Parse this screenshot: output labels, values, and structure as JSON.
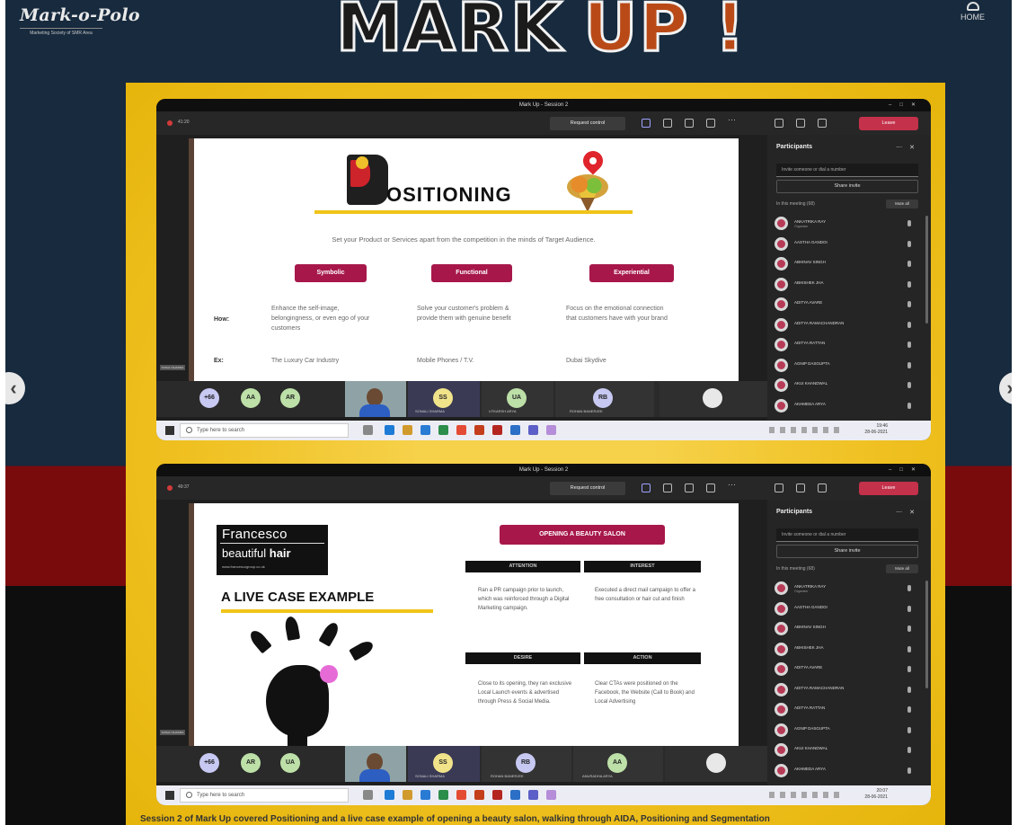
{
  "page": {
    "brand_name": "Mark-o-Polo",
    "brand_tagline": "Marketing Society of SMR Area",
    "headline_word1": "MARK",
    "headline_word2": "UP !",
    "corner_right_label": "HOME",
    "bottom_caption": "Session 2 of Mark Up covered Positioning and a live case example of opening a beauty salon, walking through AIDA, Positioning and Segmentation",
    "colors": {
      "navy": "#172a3e",
      "maroon": "#7a0b0d",
      "yellow": "#efc020",
      "slide_accent": "#a7174a",
      "leave_red": "#c4314b"
    },
    "icons": {
      "left_arrow": "chevron-left-icon",
      "right_arrow": "chevron-right-icon"
    }
  },
  "window1": {
    "title": "Mark Up - Session 2",
    "timer": "41:20",
    "request_control": "Request control",
    "leave": "Leave",
    "slide": {
      "title": "OSITIONING",
      "subtitle": "Set your Product or Services apart from the competition in the minds of Target Audience.",
      "categories": [
        "Symbolic",
        "Functional",
        "Experiential"
      ],
      "how_label": "How:",
      "how": [
        "Enhance the self-image, belongingness, or even ego of your customers",
        "Solve your customer's problem & provide them with genuine benefit",
        "Focus on the emotional connection that customers have with your brand"
      ],
      "ex_label": "Ex:",
      "examples": [
        "The Luxury Car Industry",
        "Mobile Phones / T.V.",
        "Dubai Skydive"
      ]
    },
    "strip": {
      "tiles": [
        {
          "initials": "+66",
          "label": ""
        },
        {
          "initials": "AA",
          "label": ""
        },
        {
          "initials": "AR",
          "label": ""
        },
        {
          "initials": "SS",
          "label": "SONALI SHARMA"
        },
        {
          "initials": "UA",
          "label": "UTKARSH ARYA"
        },
        {
          "initials": "RB",
          "label": "ROHAN BANERJEE"
        }
      ],
      "video_label": "SONALI SHARMA"
    },
    "taskbar": {
      "search_placeholder": "Type here to search",
      "time": "19:46",
      "date": "28-06-2021"
    }
  },
  "window2": {
    "title": "Mark Up - Session 2",
    "timer": "49:37",
    "request_control": "Request control",
    "leave": "Leave",
    "slide": {
      "logo_line1": "Francesco",
      "logo_line2a": "beautiful ",
      "logo_line2b": "hair",
      "logo_line3": "www.francescogroup.co.uk",
      "live_title": "A LIVE CASE EXAMPLE",
      "banner": "OPENING A BEAUTY SALON",
      "aida": [
        {
          "head": "ATTENTION",
          "text": "Ran a PR campaign prior to launch, which was reinforced through a Digital Marketing campaign."
        },
        {
          "head": "INTEREST",
          "text": "Executed a direct mail campaign to offer a free consultation or hair cut and finish"
        },
        {
          "head": "DESIRE",
          "text": "Close to its opening, they ran exclusive Local Launch events & advertised through Press & Social Media."
        },
        {
          "head": "ACTION",
          "text": "Clear CTAs were positioned on the Facebook, the Website (Call to Book) and Local Advertising"
        }
      ]
    },
    "strip": {
      "tiles": [
        {
          "initials": "+66",
          "label": ""
        },
        {
          "initials": "AR",
          "label": ""
        },
        {
          "initials": "UA",
          "label": ""
        },
        {
          "initials": "SS",
          "label": "SONALI SHARMA"
        },
        {
          "initials": "RB",
          "label": "ROHAN BANERJEE"
        },
        {
          "initials": "AA",
          "label": "ANURADHA ARYA"
        }
      ],
      "video_label": "SONALI SHARMA"
    },
    "taskbar": {
      "search_placeholder": "Type here to search",
      "time": "20:07",
      "date": "28-06-2021"
    }
  },
  "participants": {
    "title": "Participants",
    "invite_placeholder": "Invite someone or dial a number",
    "share_invite": "Share invite",
    "in_meeting": "In this meeting (68)",
    "mute_all": "Mute all",
    "people": [
      {
        "name": "ANKATRIKA RAY",
        "role": "Organizer"
      },
      {
        "name": "AASTHA GANDOI",
        "role": ""
      },
      {
        "name": "ABHINAV SINGH",
        "role": ""
      },
      {
        "name": "ABHISHEK JHA",
        "role": ""
      },
      {
        "name": "ADITYA AVARE",
        "role": ""
      },
      {
        "name": "ADITYA RAMACHANDRAN",
        "role": ""
      },
      {
        "name": "ADITYA RATTAN",
        "role": ""
      },
      {
        "name": "AGNIP DASGUPTA",
        "role": ""
      },
      {
        "name": "AKUI KHANDWAL",
        "role": ""
      },
      {
        "name": "AKHMEDA ARYA",
        "role": ""
      }
    ]
  }
}
